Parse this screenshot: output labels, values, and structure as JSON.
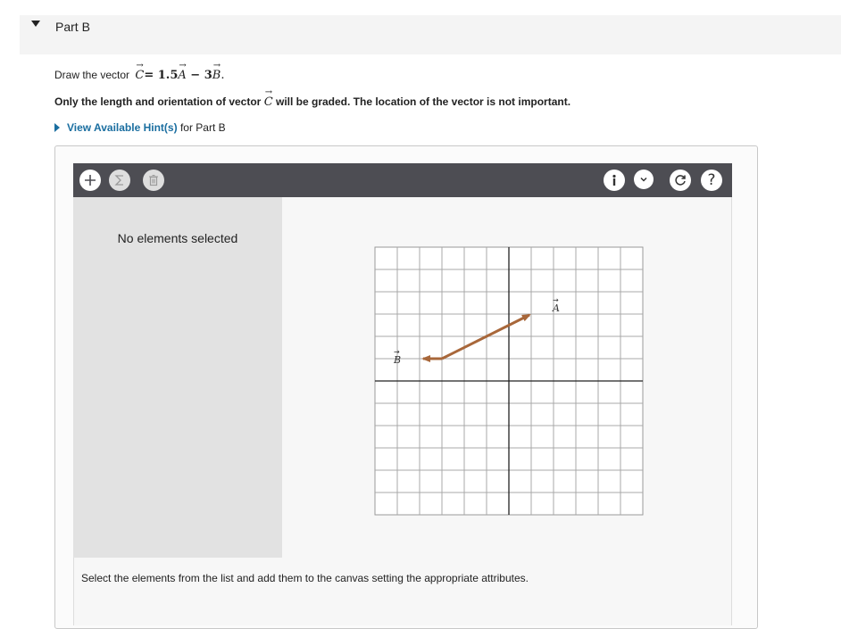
{
  "part": {
    "title": "Part B"
  },
  "prompt": {
    "draw_label": "Draw the vector",
    "equation": "C = 1.5A − 3B.",
    "eq_C": "C",
    "eq_rhs1": "= 1.5",
    "eq_A": "A",
    "eq_minus": " − 3",
    "eq_B": "B",
    "eq_end": ".",
    "note_pre": "Only the length and orientation of vector",
    "note_vec": "C",
    "note_post": "will be graded. The location of the vector is not important."
  },
  "hints": {
    "link_label": "View Available Hint(s)",
    "suffix": "for Part B"
  },
  "toolbar": {
    "left_icons": [
      "plus-icon",
      "sigma-icon",
      "trash-icon"
    ],
    "right_icons": [
      "info-icon",
      "chevron-down-icon",
      "reset-icon",
      "help-icon"
    ],
    "help_label": "?"
  },
  "side_panel": {
    "empty_text": "No elements selected"
  },
  "canvas": {
    "vector_A_label": "A",
    "vector_B_label": "B",
    "vector_color": "#a8673a"
  },
  "footer": {
    "instructions": "Select the elements from the list and add them to the canvas setting the appropriate attributes."
  }
}
